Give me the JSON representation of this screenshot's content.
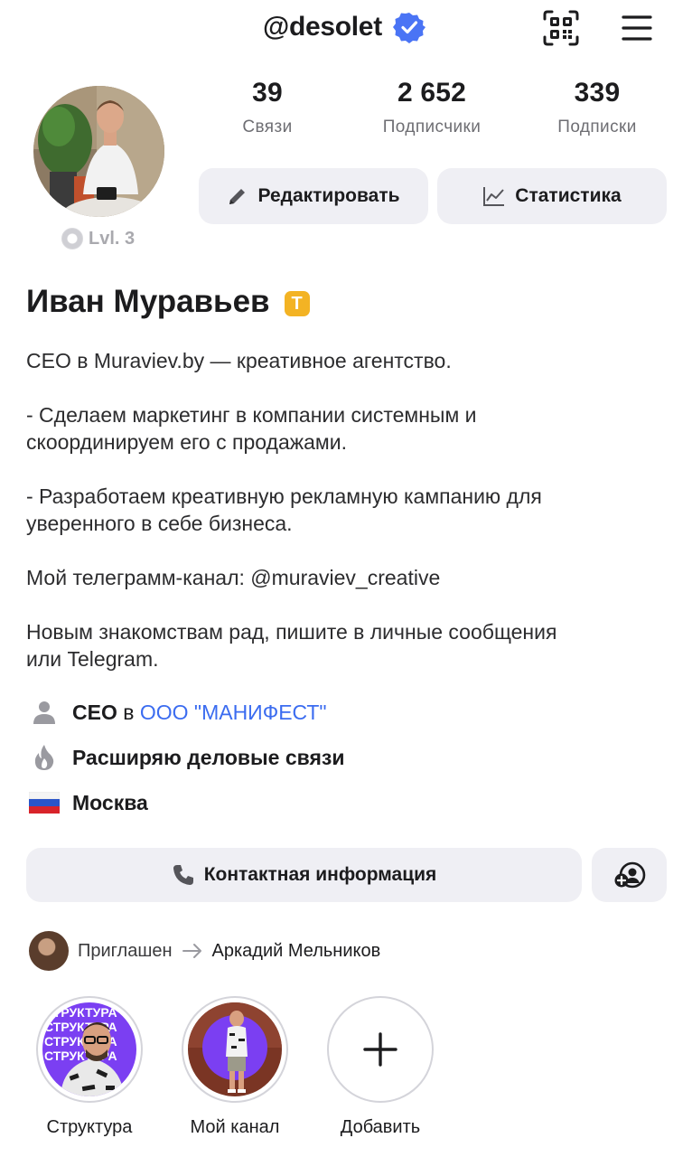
{
  "header": {
    "username": "@desolet",
    "verified_icon": "verified-check-icon",
    "qr_icon": "qr-code-icon",
    "menu_icon": "hamburger-menu-icon"
  },
  "profile": {
    "level": "Lvl. 3",
    "stats": [
      {
        "value": "39",
        "label": "Связи"
      },
      {
        "value": "2 652",
        "label": "Подписчики"
      },
      {
        "value": "339",
        "label": "Подписки"
      }
    ],
    "edit_label": "Редактировать",
    "stats_label": "Статистика",
    "name": "Иван Муравьев",
    "badge": "T",
    "badge_color": "#f3b324"
  },
  "bio": {
    "line1": "CEO в Muraviev.by — креативное агентство.",
    "para2a": "- Сделаем маркетинг в компании системным и",
    "para2b": "скоординируем его с продажами.",
    "para3a": "- Разработаем креативную рекламную кампанию для",
    "para3b": "уверенного в себе бизнеса.",
    "para4": "Мой телеграмм-канал: @muraviev_creative",
    "para5a": "Новым знакомствам рад, пишите в личные сообщения",
    "para5b": "или Telegram."
  },
  "info": {
    "job_title": "CEO",
    "job_in": "в",
    "company": "ООО \"МАНИФЕСТ\"",
    "goal": "Расширяю деловые связи",
    "city": "Москва",
    "link_color": "#3b6cf0"
  },
  "contact": {
    "label": "Контактная информация"
  },
  "invited": {
    "label": "Приглашен",
    "name": "Аркадий Мельников"
  },
  "stories": [
    {
      "caption": "Структура",
      "overlay": "СТРУКТУРА"
    },
    {
      "caption": "Мой канал"
    },
    {
      "caption": "Добавить"
    }
  ],
  "colors": {
    "pill_bg": "#efeff4",
    "muted": "#6e6e73",
    "verified": "#4a74f5",
    "accent_purple": "#7b3ff2"
  }
}
